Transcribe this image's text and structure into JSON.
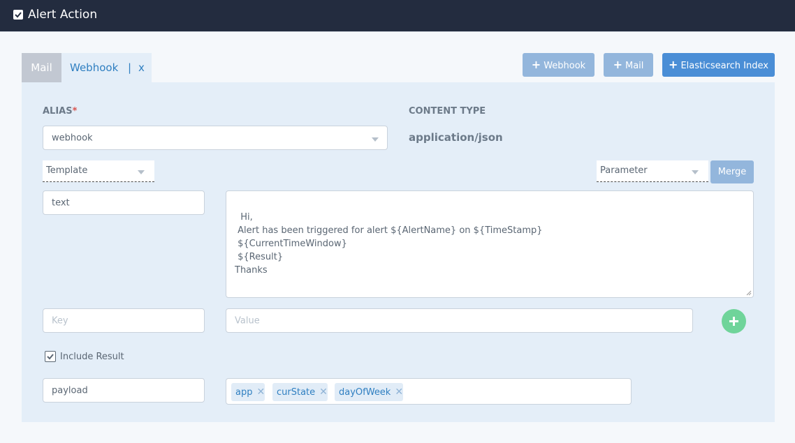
{
  "header": {
    "title": "Alert Action"
  },
  "tabs": {
    "mail": "Mail",
    "webhook": "Webhook",
    "separator": "|",
    "close": "x"
  },
  "buttons": {
    "add_webhook": "Webhook",
    "add_mail": "Mail",
    "add_es": "Elasticsearch Index",
    "merge": "Merge"
  },
  "form": {
    "alias_label": "ALIAS",
    "alias_required": "*",
    "alias_value": "webhook",
    "content_type_label": "CONTENT TYPE",
    "content_type_value": "application/json",
    "template_select": "Template",
    "parameter_select": "Parameter",
    "body_key": "text",
    "body_value": "Hi,\n Alert has been triggered for alert ${AlertName} on ${TimeStamp}\n ${CurrentTimeWindow}\n ${Result}\nThanks",
    "key_placeholder": "Key",
    "value_placeholder": "Value",
    "include_result_label": "Include Result",
    "include_result_checked": true,
    "payload_key": "payload",
    "payload_tags": [
      "app",
      "curState",
      "dayOfWeek"
    ]
  },
  "colors": {
    "topbar": "#232c3f",
    "accent": "#4a8ed6",
    "add_green": "#6fd49a"
  }
}
